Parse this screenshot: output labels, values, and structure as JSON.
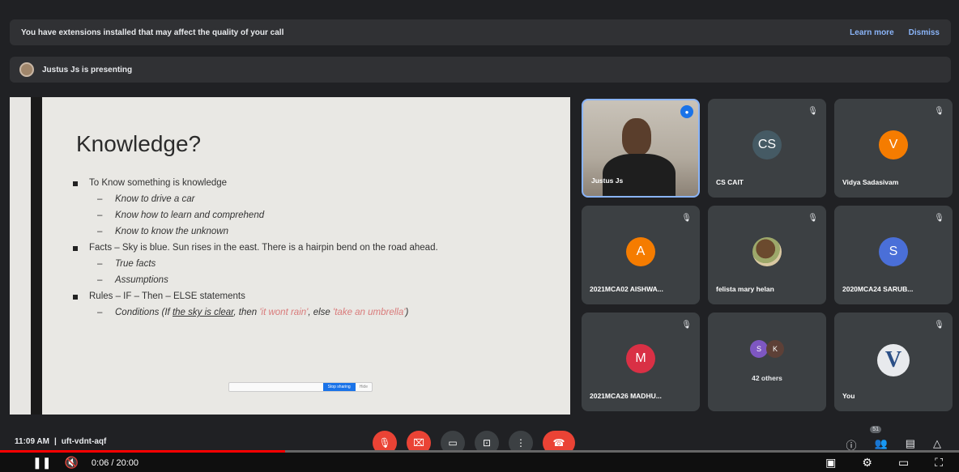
{
  "banners": {
    "extension_warning": "You have extensions installed that may affect the quality of your call",
    "learn_more": "Learn more",
    "dismiss": "Dismiss",
    "presenting": "Justus Js is presenting"
  },
  "slide": {
    "title": "Knowledge?",
    "b1": "To Know something is knowledge",
    "b1_1": "Know to drive a car",
    "b1_2": "Know how to learn and comprehend",
    "b1_3": "Know to know the unknown",
    "b2": "Facts – Sky is blue. Sun rises in the east. There is a hairpin bend on the road ahead.",
    "b2_1": "True facts",
    "b2_2": "Assumptions",
    "b3": "Rules – IF – Then – ELSE statements",
    "b3_1_a": "Conditions (If ",
    "b3_1_b": "the sky is clear",
    "b3_1_c": ", then ",
    "b3_1_d": "'it wont rain'",
    "b3_1_e": ", else ",
    "b3_1_f": "'take an umbrella'",
    "b3_1_g": ")",
    "mini_bar_primary": "Stop sharing",
    "mini_bar_secondary": "Hide"
  },
  "tiles": {
    "t1_name": "Justus Js",
    "t2_initials": "CS",
    "t2_name": "CS CAIT",
    "t3_initials": "V",
    "t3_name": "Vidya Sadasivam",
    "t4_initials": "A",
    "t4_name": "2021MCA02 AISHWA...",
    "t5_name": "felista mary helan",
    "t6_initials": "S",
    "t6_name": "2020MCA24 SARUB...",
    "t7_initials": "M",
    "t7_name": "2021MCA26 MADHU...",
    "t8_c1": "S",
    "t8_c2": "K",
    "t8_others": "42 others",
    "t9_name": "You",
    "t9_logo": "V"
  },
  "meeting": {
    "time": "11:09 AM",
    "separator": "|",
    "code": "uft-vdnt-aqf",
    "participants_badge": "51"
  },
  "player": {
    "time": "0:06 / 20:00"
  },
  "colors": {
    "orange_avatar": "#f57c00",
    "blue_avatar": "#4a6fd8",
    "red_avatar": "#d93045",
    "cs_avatar": "#455a64",
    "end_call": "#ea4335",
    "progress": "#ff0000"
  }
}
